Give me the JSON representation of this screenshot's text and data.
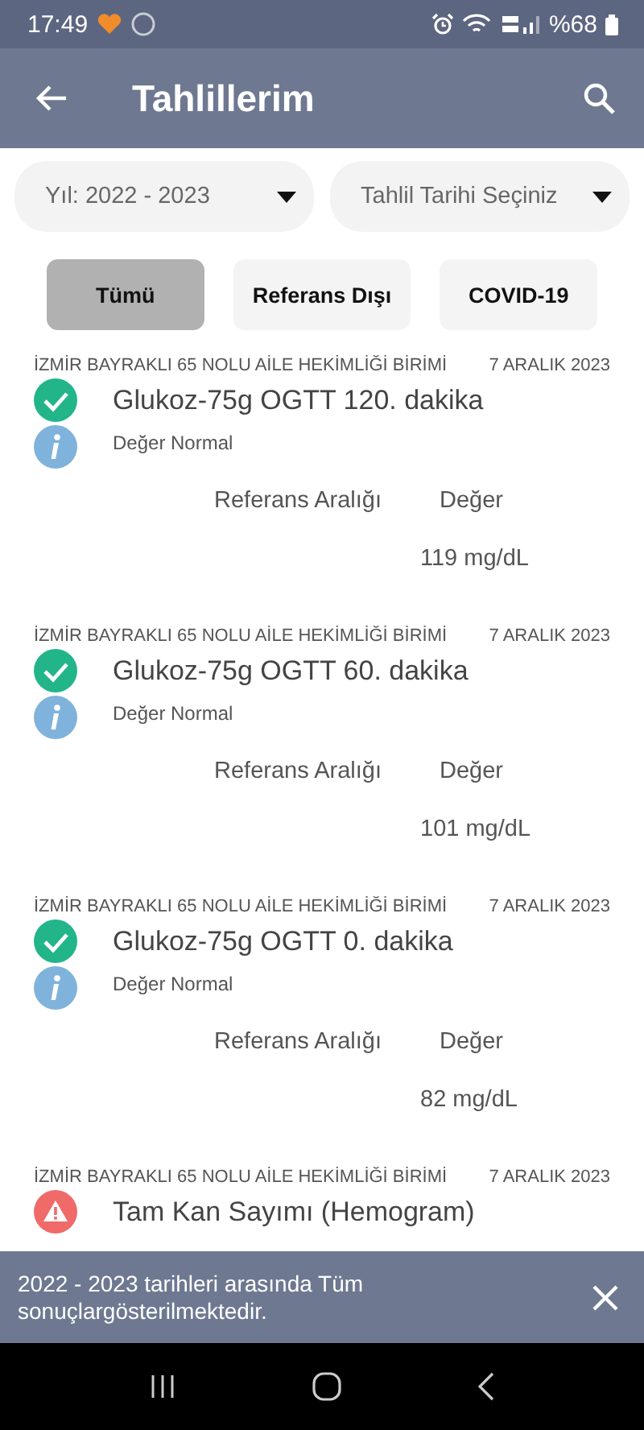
{
  "status_bar": {
    "time": "17:49",
    "battery": "%68"
  },
  "app_bar": {
    "title": "Tahlillerim"
  },
  "filters": [
    {
      "value": "Yıl: 2022 - 2023"
    },
    {
      "value": "Tahlil Tarihi Seçiniz"
    }
  ],
  "chips": [
    {
      "label": "Tümü",
      "selected": true
    },
    {
      "label": "Referans Dışı",
      "selected": false
    },
    {
      "label": "COVID-19",
      "selected": false
    }
  ],
  "results": [
    {
      "institution": "İZMİR BAYRAKLI 65 NOLU AİLE HEKİMLİĞİ BİRİMİ",
      "date": "7 ARALIK 2023",
      "kind": "normal",
      "title": "Glukoz-75g OGTT 120. dakika",
      "note": "Değer Normal",
      "ref_label": "Referans Aralığı",
      "value_label": "Değer",
      "value": "119 mg/dL"
    },
    {
      "institution": "İZMİR BAYRAKLI 65 NOLU AİLE HEKİMLİĞİ BİRİMİ",
      "date": "7 ARALIK 2023",
      "kind": "normal",
      "title": "Glukoz-75g OGTT 60. dakika",
      "note": "Değer Normal",
      "ref_label": "Referans Aralığı",
      "value_label": "Değer",
      "value": "101 mg/dL"
    },
    {
      "institution": "İZMİR BAYRAKLI 65 NOLU AİLE HEKİMLİĞİ BİRİMİ",
      "date": "7 ARALIK 2023",
      "kind": "normal",
      "title": "Glukoz-75g OGTT 0. dakika",
      "note": "Değer Normal",
      "ref_label": "Referans Aralığı",
      "value_label": "Değer",
      "value": "82 mg/dL"
    },
    {
      "institution": "İZMİR BAYRAKLI 65 NOLU AİLE HEKİMLİĞİ BİRİMİ",
      "date": "7 ARALIK 2023",
      "kind": "warning",
      "title": "Tam Kan Sayımı (Hemogram)"
    }
  ],
  "snackbar": {
    "message": "2022 - 2023 tarihleri arasında Tüm sonuçlargösterilmektedir."
  }
}
